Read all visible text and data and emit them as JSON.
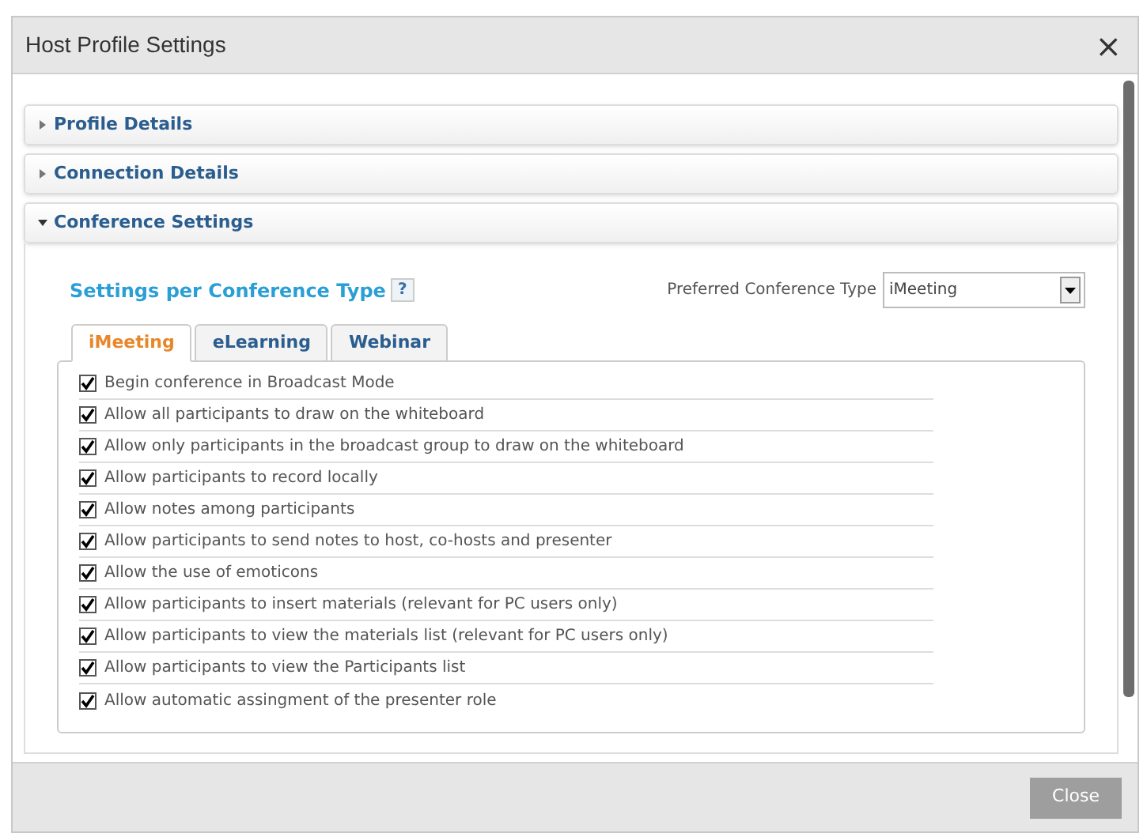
{
  "window": {
    "title": "Host Profile Settings",
    "close": "×"
  },
  "sections": [
    {
      "title": "Profile Details",
      "expanded": false
    },
    {
      "title": "Connection Details",
      "expanded": false
    },
    {
      "title": "Conference Settings",
      "expanded": true
    }
  ],
  "conference": {
    "heading": "Settings per Conference Type",
    "help": "?",
    "preferred_label": "Preferred Conference Type",
    "preferred_value": "iMeeting",
    "tabs": [
      {
        "label": "iMeeting",
        "selected": true
      },
      {
        "label": "eLearning",
        "selected": false
      },
      {
        "label": "Webinar",
        "selected": false
      }
    ],
    "options": [
      {
        "label": "Begin conference in Broadcast Mode",
        "checked": true
      },
      {
        "label": "Allow all participants to draw on the whiteboard",
        "checked": true
      },
      {
        "label": "Allow only participants in the broadcast group to draw on the whiteboard",
        "checked": true
      },
      {
        "label": "Allow participants to record locally",
        "checked": true
      },
      {
        "label": "Allow notes among participants",
        "checked": true
      },
      {
        "label": "Allow participants to send notes to host, co-hosts and presenter",
        "checked": true
      },
      {
        "label": "Allow the use of emoticons",
        "checked": true
      },
      {
        "label": "Allow participants to insert materials (relevant for PC users only)",
        "checked": true
      },
      {
        "label": "Allow participants to view the materials list (relevant for PC users only)",
        "checked": true
      },
      {
        "label": "Allow participants to view the Participants list",
        "checked": true
      },
      {
        "label": "Allow automatic assingment of the presenter role",
        "checked": true
      }
    ]
  },
  "footer": {
    "button": "Close"
  }
}
